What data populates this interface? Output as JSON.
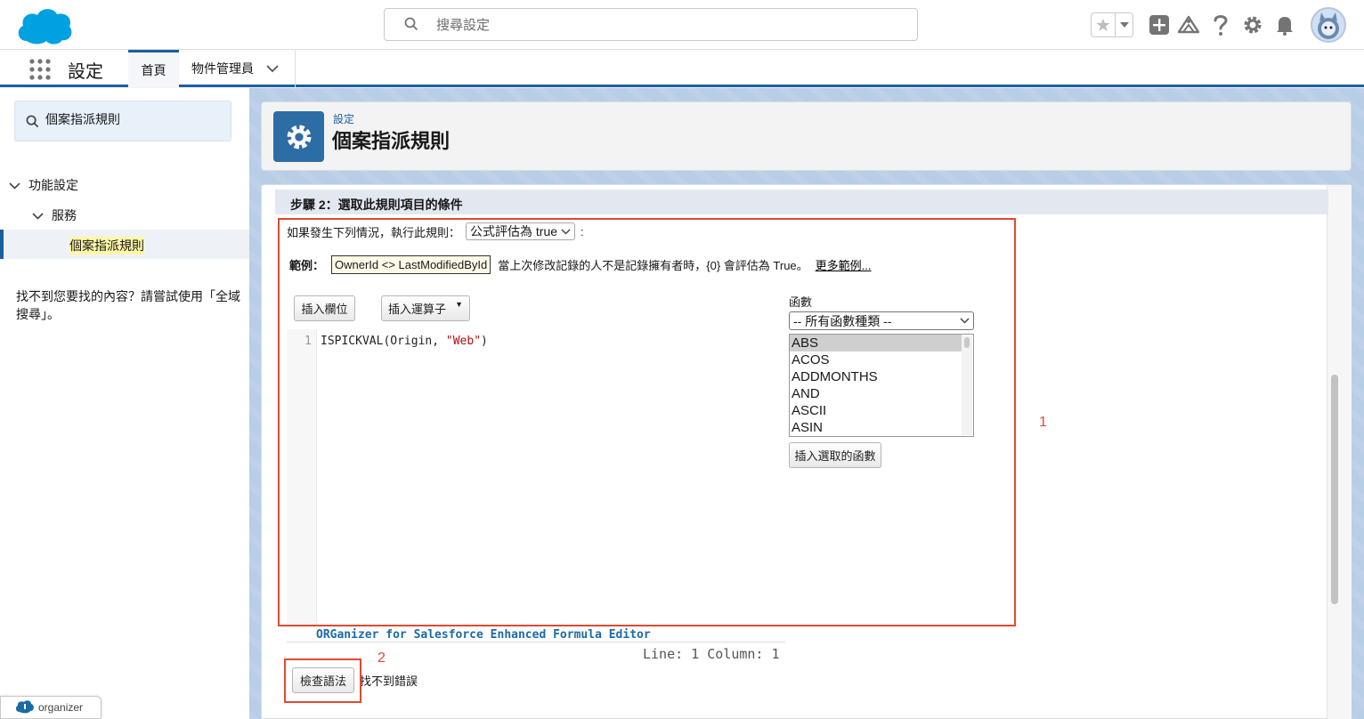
{
  "header": {
    "search_placeholder": "搜尋設定"
  },
  "context_bar": {
    "app_name": "設定",
    "tabs": [
      {
        "label": "首頁"
      },
      {
        "label": "物件管理員"
      }
    ]
  },
  "sidebar": {
    "quick_find_value": "個案指派規則",
    "tree": {
      "level1": "功能設定",
      "level2": "服務",
      "level3": "個案指派規則"
    },
    "not_found_text": "找不到您要找的內容？請嘗試使用「全域搜尋」。",
    "organizer_badge": "organizer"
  },
  "page_header": {
    "breadcrumb": "設定",
    "title": "個案指派規則"
  },
  "step": {
    "title": "步驟 2：選取此規則項目的條件",
    "condition_label": "如果發生下列情況，執行此規則：",
    "condition_select": "公式評估為 true",
    "condition_suffix": ":"
  },
  "example": {
    "label": "範例：",
    "formula": "OwnerId <> LastModifiedById",
    "description": "當上次修改記錄的人不是記錄擁有者時，{0} 會評估為 True。",
    "more_link": "更多範例..."
  },
  "editor_toolbar": {
    "insert_field": "插入欄位",
    "insert_operator": "插入運算子"
  },
  "editor": {
    "line_number": "1",
    "code_fn": "ISPICKVAL",
    "code_args": "(Origin, ",
    "code_str": "\"Web\"",
    "code_end": ")",
    "footer_name": "ORGanizer for Salesforce Enhanced Formula Editor",
    "line_col": "Line: 1 Column: 1"
  },
  "functions": {
    "label": "函數",
    "category_select": "-- 所有函數種類 --",
    "list": [
      "ABS",
      "ACOS",
      "ADDMONTHS",
      "AND",
      "ASCII",
      "ASIN"
    ],
    "insert_button": "插入選取的函數"
  },
  "check": {
    "button": "檢查語法",
    "result": "找不到錯誤"
  },
  "annotations": {
    "box1": "1",
    "box2": "2",
    "color": "#e04a2f"
  },
  "colors": {
    "brand": "#1b5f9e",
    "icon_bg": "#2d6da5"
  }
}
